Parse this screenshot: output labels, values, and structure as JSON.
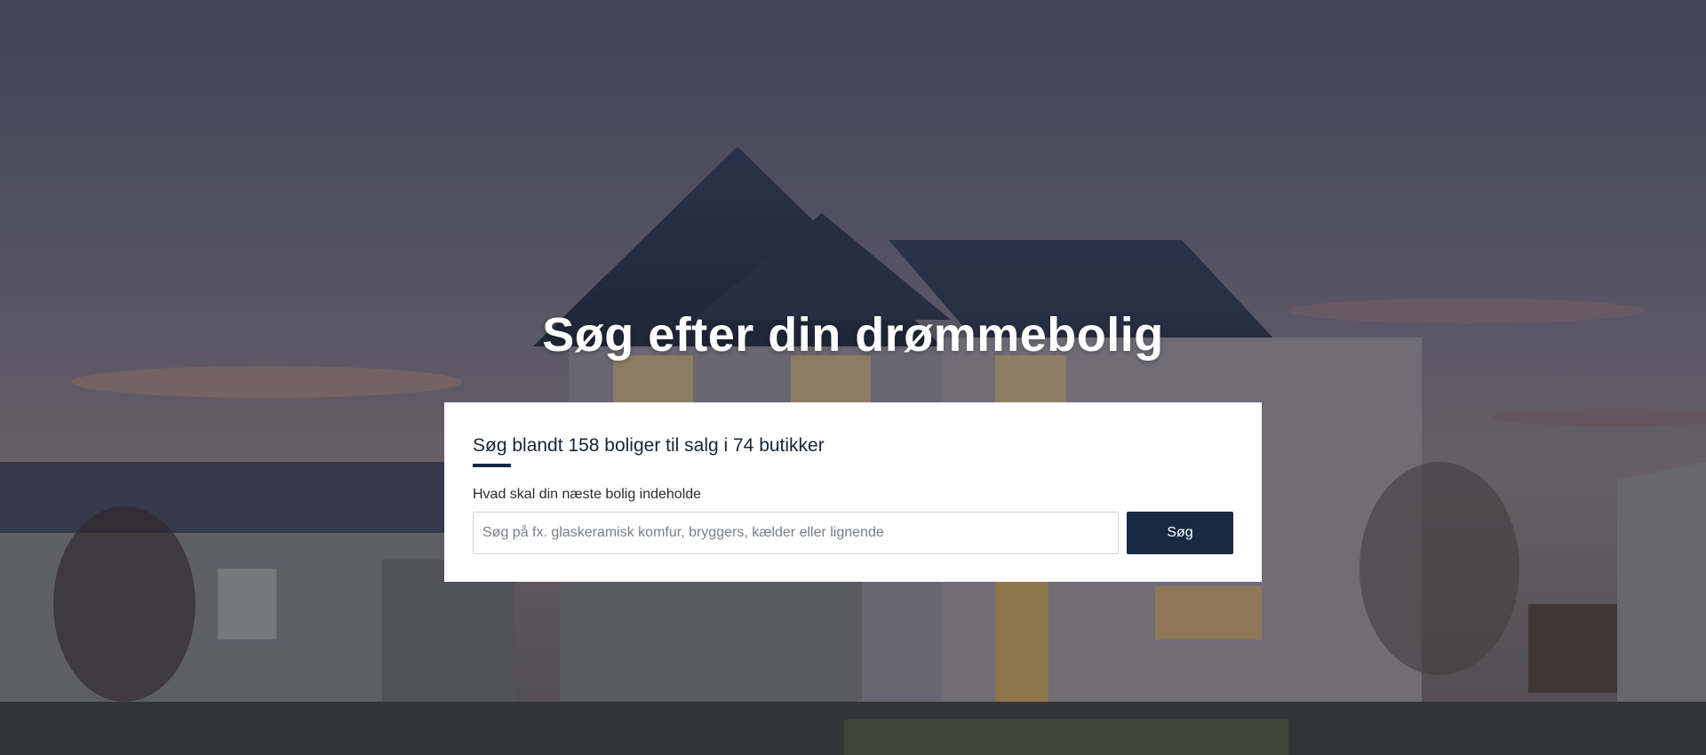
{
  "hero": {
    "title": "Søg efter din drømmebolig",
    "background_image": "house-at-dusk"
  },
  "search_card": {
    "heading": "Søg blandt 158 boliger til salg i 74 butikker",
    "field_label": "Hvad skal din næste bolig indeholde",
    "input_value": "",
    "input_placeholder": "Søg på fx. glaskeramisk komfur, bryggers, kælder eller lignende",
    "button_label": "Søg"
  },
  "colors": {
    "accent": "#172a43",
    "title_text": "#ffffff"
  }
}
